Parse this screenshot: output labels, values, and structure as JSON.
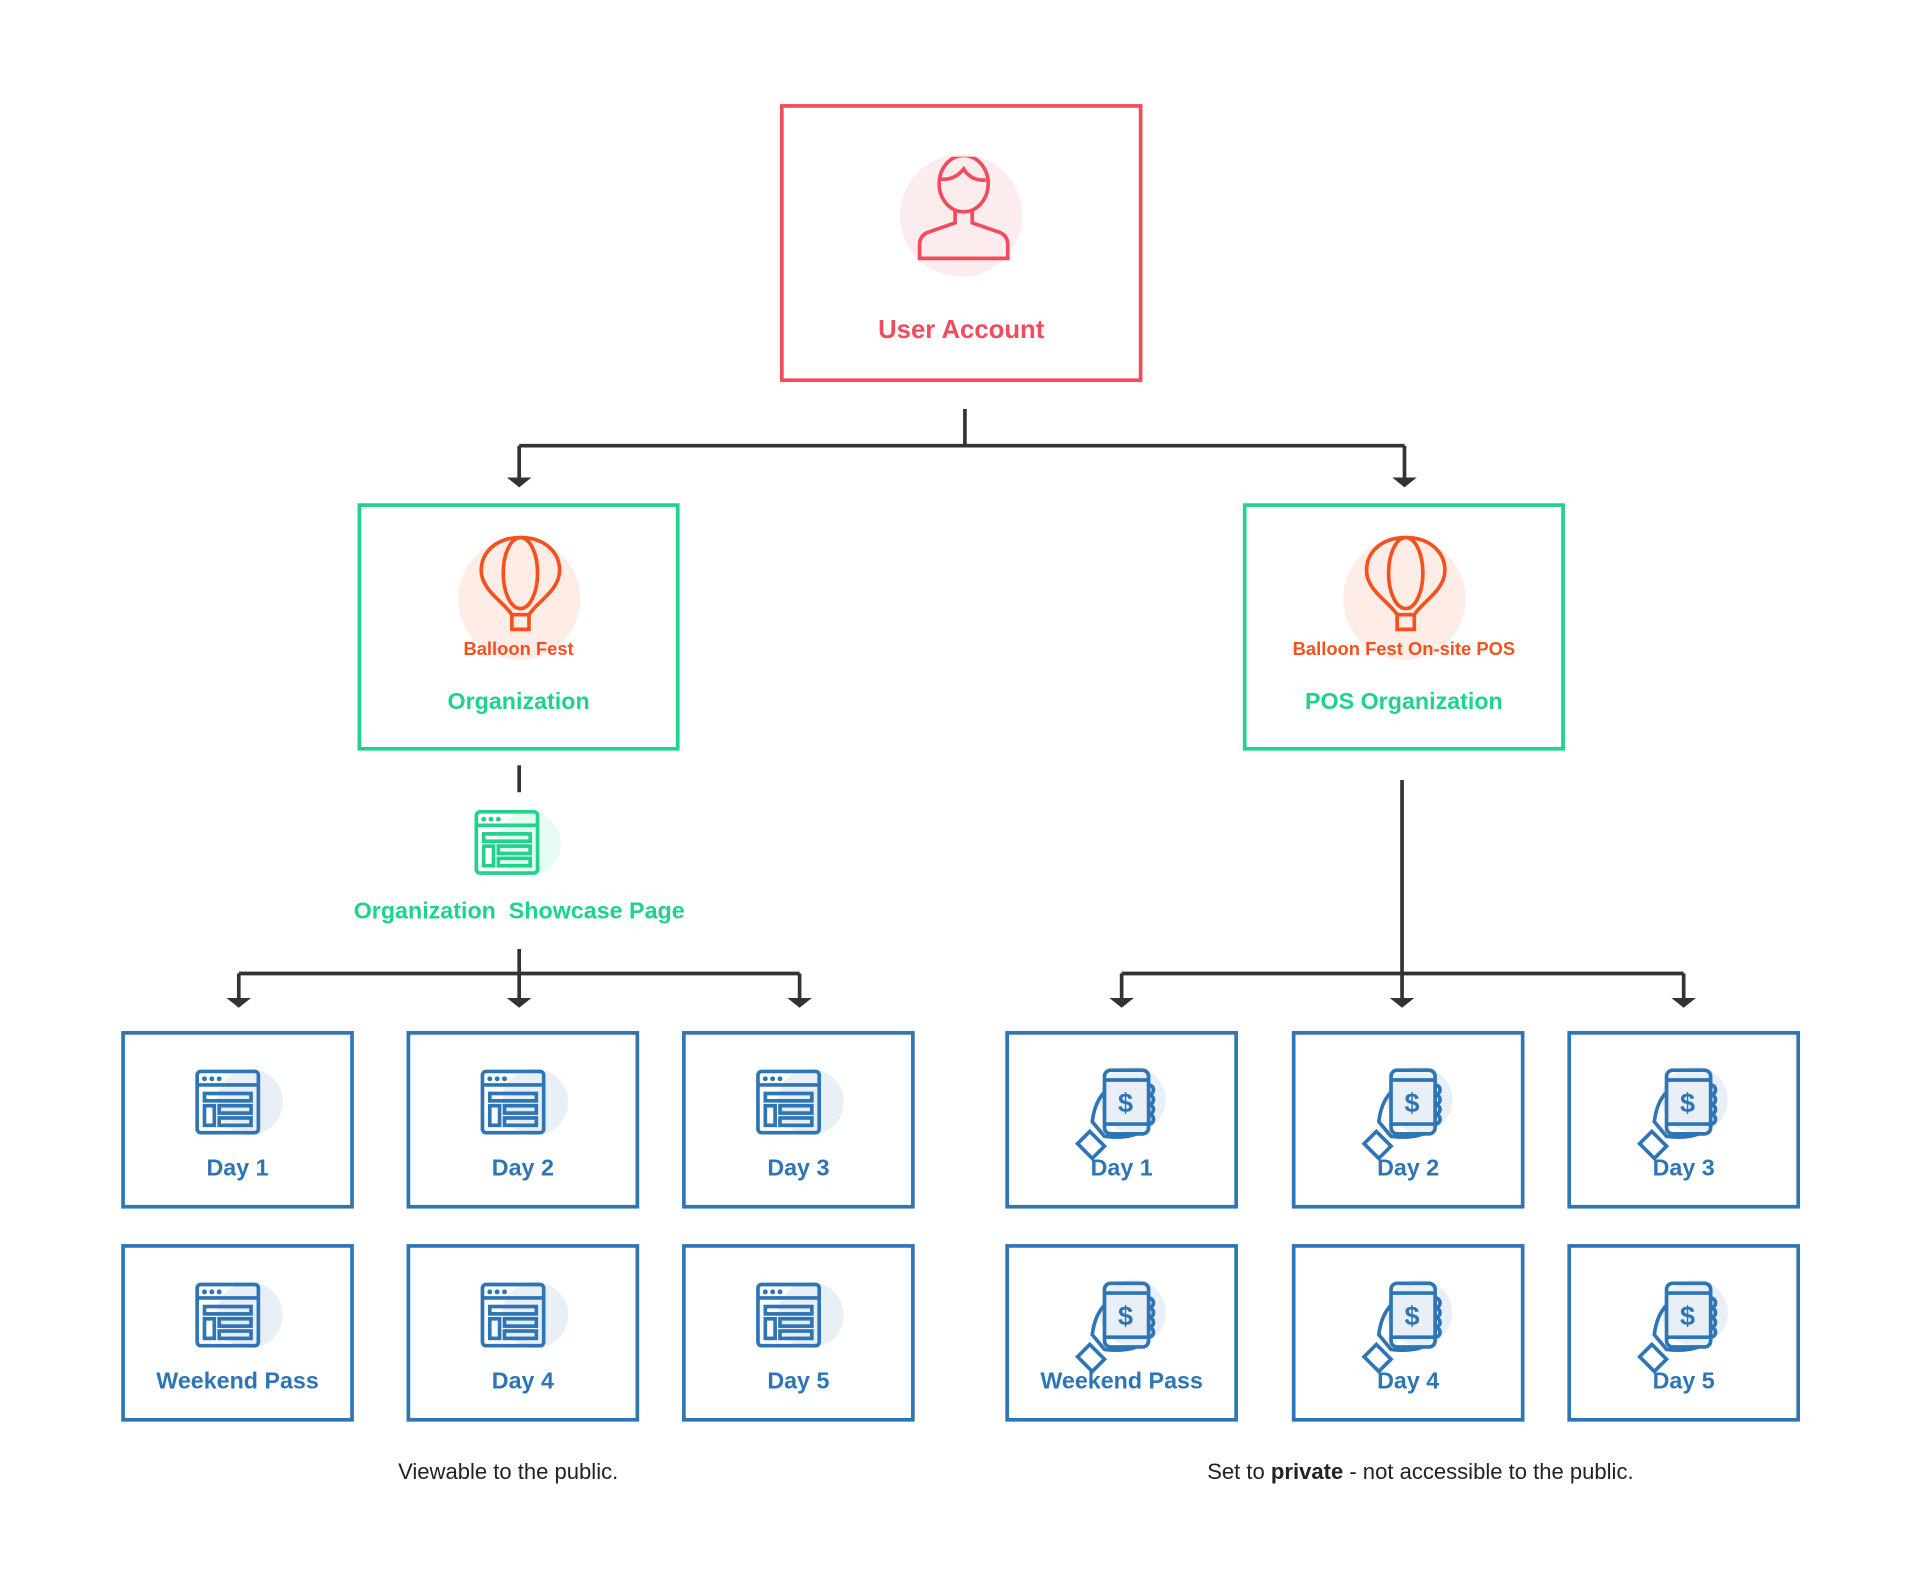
{
  "colors": {
    "user": "#f24b5e",
    "org": "#1fd38a",
    "balloon": "#f4511e",
    "item": "#2e75b6"
  },
  "user_account": {
    "label": "User Account",
    "icon": "user-icon"
  },
  "organizations": [
    {
      "name": "Balloon Fest",
      "type_label": "Organization",
      "icon": "hot-air-balloon-icon"
    },
    {
      "name": "Balloon Fest On-site POS",
      "type_label": "POS Organization",
      "icon": "hot-air-balloon-icon"
    }
  ],
  "showcase": {
    "label": "Organization  Showcase Page",
    "icon": "web-page-icon"
  },
  "left_items": [
    {
      "label": "Day 1",
      "icon": "web-page-icon"
    },
    {
      "label": "Day 2",
      "icon": "web-page-icon"
    },
    {
      "label": "Day 3",
      "icon": "web-page-icon"
    },
    {
      "label": "Weekend Pass",
      "icon": "web-page-icon"
    },
    {
      "label": "Day 4",
      "icon": "web-page-icon"
    },
    {
      "label": "Day 5",
      "icon": "web-page-icon"
    }
  ],
  "right_items": [
    {
      "label": "Day 1",
      "icon": "mobile-payment-icon"
    },
    {
      "label": "Day 2",
      "icon": "mobile-payment-icon"
    },
    {
      "label": "Day 3",
      "icon": "mobile-payment-icon"
    },
    {
      "label": "Weekend Pass",
      "icon": "mobile-payment-icon"
    },
    {
      "label": "Day 4",
      "icon": "mobile-payment-icon"
    },
    {
      "label": "Day 5",
      "icon": "mobile-payment-icon"
    }
  ],
  "captions": {
    "left": "Viewable to the public.",
    "right_prefix": "Set to ",
    "right_bold": "private",
    "right_suffix": " - not accessible to the public."
  }
}
